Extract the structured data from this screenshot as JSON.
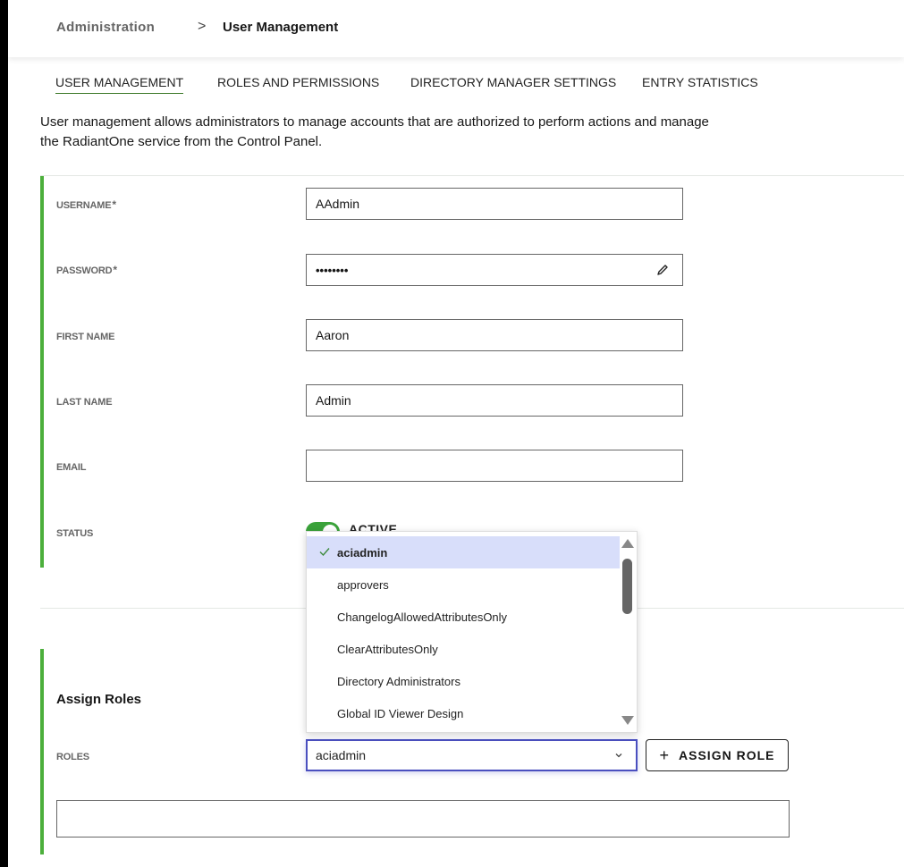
{
  "breadcrumb": {
    "root": "Administration",
    "separator": ">",
    "current": "User Management"
  },
  "tabs": [
    {
      "label": "USER MANAGEMENT",
      "active": true
    },
    {
      "label": "ROLES AND PERMISSIONS",
      "active": false
    },
    {
      "label": "DIRECTORY MANAGER SETTINGS",
      "active": false
    },
    {
      "label": "ENTRY STATISTICS",
      "active": false
    }
  ],
  "description": "User management allows administrators to manage accounts that are authorized to perform actions and manage the RadiantOne service from the Control Panel.",
  "form": {
    "username": {
      "label": "USERNAME",
      "required_mark": "*",
      "value": "AAdmin"
    },
    "password": {
      "label": "PASSWORD",
      "required_mark": "*",
      "value": "••••••••",
      "icon": "pencil-icon"
    },
    "first_name": {
      "label": "FIRST NAME",
      "value": "Aaron"
    },
    "last_name": {
      "label": "LAST NAME",
      "value": "Admin"
    },
    "email": {
      "label": "EMAIL",
      "value": ""
    },
    "status": {
      "label": "STATUS",
      "value": "ACTIVE",
      "enabled": true
    }
  },
  "assign_roles": {
    "title": "Assign Roles",
    "roles_label": "ROLES",
    "selected_role": "aciadmin",
    "assign_button": "ASSIGN ROLE",
    "assign_button_icon": "+",
    "dropdown_options": [
      {
        "label": "aciadmin",
        "selected": true
      },
      {
        "label": "approvers",
        "selected": false
      },
      {
        "label": "ChangelogAllowedAttributesOnly",
        "selected": false
      },
      {
        "label": "ClearAttributesOnly",
        "selected": false
      },
      {
        "label": "Directory Administrators",
        "selected": false
      },
      {
        "label": "Global ID Viewer Design",
        "selected": false
      }
    ]
  },
  "colors": {
    "accent_green": "#4caf3c",
    "focus_blue": "#4a4fbf",
    "selected_bg": "#d8defa"
  }
}
